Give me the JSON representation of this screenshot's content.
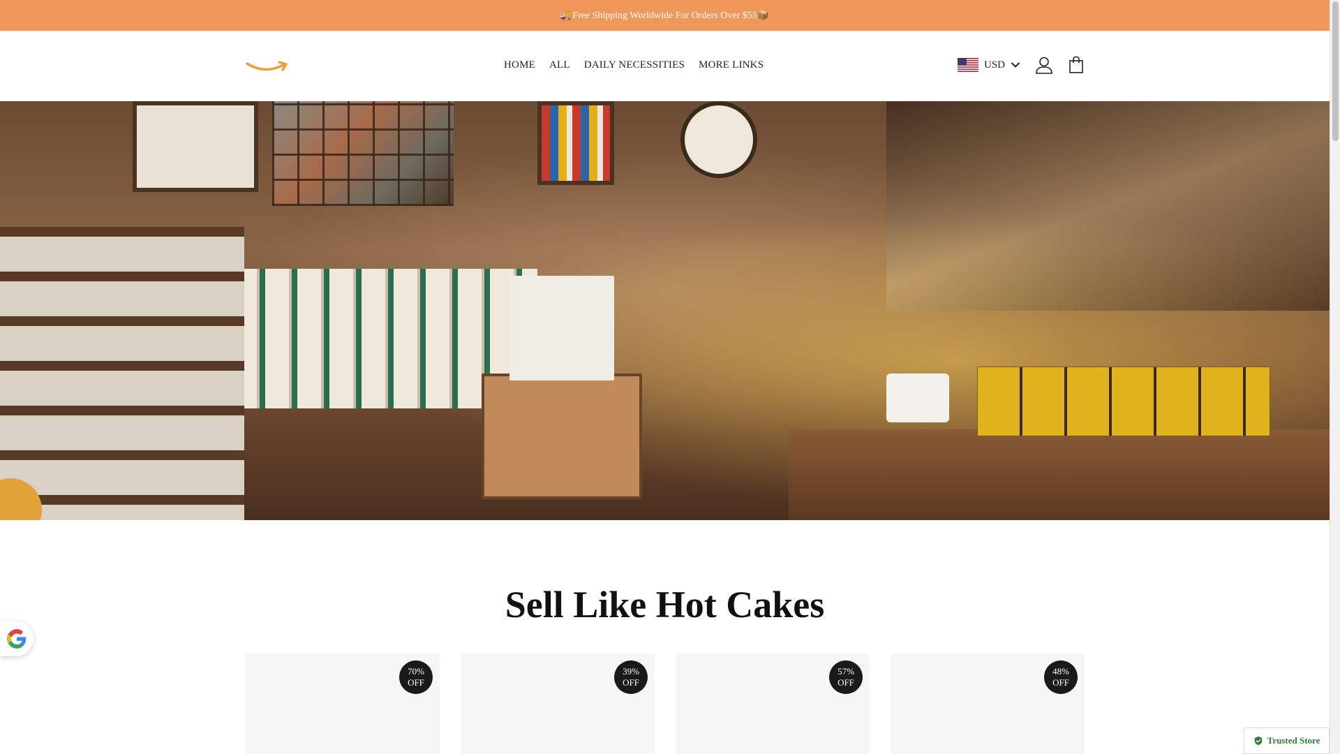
{
  "announcement": {
    "text": "🚚Free Shipping Worldwide For Orders Over $55📦"
  },
  "header": {
    "nav": [
      {
        "label": "HOME"
      },
      {
        "label": "ALL"
      },
      {
        "label": "DAILY NECESSITIES"
      },
      {
        "label": "MORE LINKS"
      }
    ],
    "currency": {
      "code": "USD",
      "flag": "us-flag"
    },
    "icons": [
      "user-icon",
      "shopping-bag-icon",
      "chevron-down-icon"
    ]
  },
  "section": {
    "title": "Sell Like Hot Cakes"
  },
  "products": [
    {
      "discount_pct": "70%",
      "discount_word": "OFF"
    },
    {
      "discount_pct": "39%",
      "discount_word": "OFF"
    },
    {
      "discount_pct": "57%",
      "discount_word": "OFF"
    },
    {
      "discount_pct": "48%",
      "discount_word": "OFF"
    }
  ],
  "trusted_badge": {
    "label": "Trusted Store"
  },
  "colors": {
    "announcement_bg": "#f0985a",
    "logo_accent": "#f29c38",
    "badge_bg": "#1a1a1a",
    "trusted_green": "#2e7d32"
  }
}
